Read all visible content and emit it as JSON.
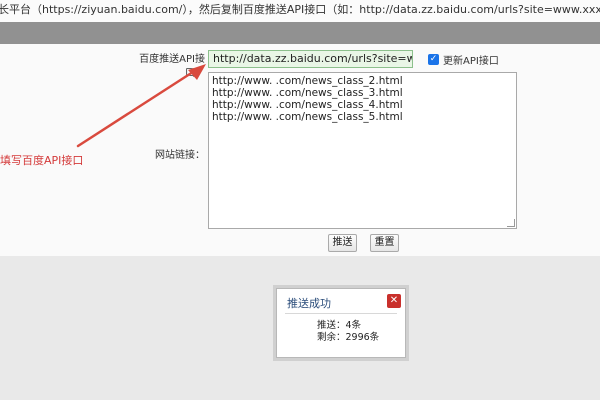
{
  "top_instruction": "长平台（https://ziyuan.baidu.com/），然后复制百度推送API接口（如：http://data.zz.baidu.com/urls?site=www.xxx.com&token=gPWD",
  "form": {
    "api_label": "百度推送API接口：",
    "api_value": "http://data.zz.baidu.com/urls?site=www.hn",
    "update_checkbox_label": "更新API接口",
    "update_checked": true,
    "links_label": "网站链接：",
    "links": [
      "http://www.          .com/news_class_2.html",
      "http://www.          .com/news_class_3.html",
      "http://www.          .com/news_class_4.html",
      "http://www.          .com/news_class_5.html"
    ],
    "push_button": "推送",
    "reset_button": "重置"
  },
  "annotation": {
    "text": "填写百度API接口",
    "color": "#d43a3a"
  },
  "dialog": {
    "title": "推送成功",
    "pushed_line": "推送：4条",
    "remaining_line": "剩余：2996条"
  },
  "colors": {
    "accent": "#1a73e8",
    "close": "#c9302c",
    "dialog_title": "#2a4c7a"
  }
}
